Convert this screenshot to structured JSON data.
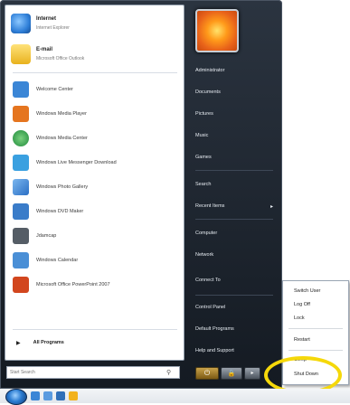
{
  "pinned": [
    {
      "title": "Internet",
      "subtitle": "Internet Explorer",
      "icon": "internet-explorer-icon",
      "color": "#2f7fd8"
    },
    {
      "title": "E-mail",
      "subtitle": "Microsoft Office Outlook",
      "icon": "outlook-icon",
      "color": "#e8b21e"
    }
  ],
  "recent_programs": [
    {
      "label": "Welcome Center",
      "icon": "welcome-center-icon",
      "color": "#3b86d6"
    },
    {
      "label": "Windows Media Player",
      "icon": "media-player-icon",
      "color": "#e5751f"
    },
    {
      "label": "Windows Media Center",
      "icon": "media-center-icon",
      "color": "#1f8a3b"
    },
    {
      "label": "Windows Live Messenger Download",
      "icon": "messenger-icon",
      "color": "#3aa0e0"
    },
    {
      "label": "Windows Photo Gallery",
      "icon": "photo-gallery-icon",
      "color": "#2b6fc4"
    },
    {
      "label": "Windows DVD Maker",
      "icon": "dvd-maker-icon",
      "color": "#3a7cc9"
    },
    {
      "label": "Jdamcap",
      "icon": "jdamcap-icon",
      "color": "#555d66"
    },
    {
      "label": "Windows Calendar",
      "icon": "calendar-icon",
      "color": "#4a8fd6"
    },
    {
      "label": "Microsoft Office PowerPoint 2007",
      "icon": "powerpoint-icon",
      "color": "#d2461e"
    }
  ],
  "all_programs": {
    "arrow": "▶",
    "label": "All Programs"
  },
  "search": {
    "placeholder": "Start Search",
    "icon": "search-icon"
  },
  "right_items": [
    {
      "label": "Administrator"
    },
    {
      "label": "Documents"
    },
    {
      "label": "Pictures"
    },
    {
      "label": "Music"
    },
    {
      "label": "Games"
    },
    {
      "label": "Search"
    },
    {
      "label": "Recent Items",
      "submenu": "▸"
    },
    {
      "label": "Computer"
    },
    {
      "label": "Network"
    },
    {
      "label": "Connect To"
    },
    {
      "label": "Control Panel"
    },
    {
      "label": "Default Programs"
    },
    {
      "label": "Help and Support"
    }
  ],
  "power": {
    "power_glyph": "⏻",
    "lock_glyph": "🔒",
    "arrow_glyph": "▸"
  },
  "shutdown_menu": [
    {
      "label": "Switch User"
    },
    {
      "label": "Log Off"
    },
    {
      "label": "Lock"
    },
    {
      "label": "Restart"
    },
    {
      "label": "Sleep"
    },
    {
      "label": "Shut Down"
    }
  ],
  "taskbar": {
    "quick_launch_colors": [
      "#3b86d6",
      "#5a9be0",
      "#2f6fb8",
      "#f2b21c"
    ]
  }
}
